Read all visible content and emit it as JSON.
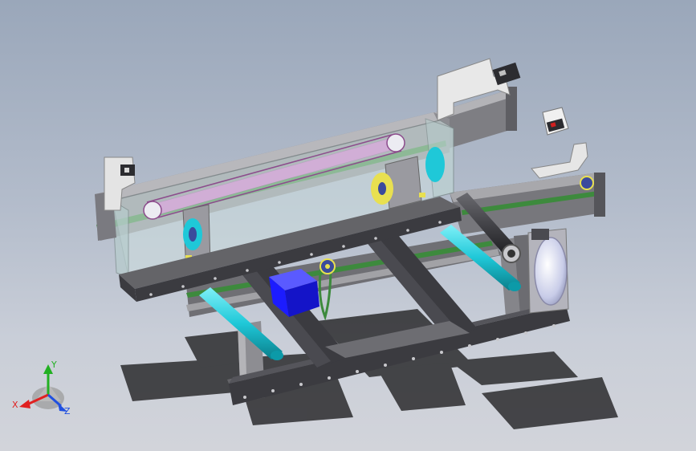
{
  "viewport": {
    "background_top": "#9aa7ba",
    "background_bottom": "#d2d4da"
  },
  "model": {
    "colors": {
      "frame_dark": "#3b3b40",
      "frame_light": "#9c9c9c",
      "rail": "#8a8a8e",
      "belt_green": "#3d8a3d",
      "cyan_rod": "#1fc8d8",
      "motor_blue": "#1c1cff",
      "pulley_yellow": "#e8e050",
      "glass": "#cfe0e0"
    }
  },
  "triad": {
    "x_label": "X",
    "y_label": "Y",
    "z_label": "Z",
    "x_color": "#e02020",
    "y_color": "#22b022",
    "z_color": "#2050e0"
  }
}
